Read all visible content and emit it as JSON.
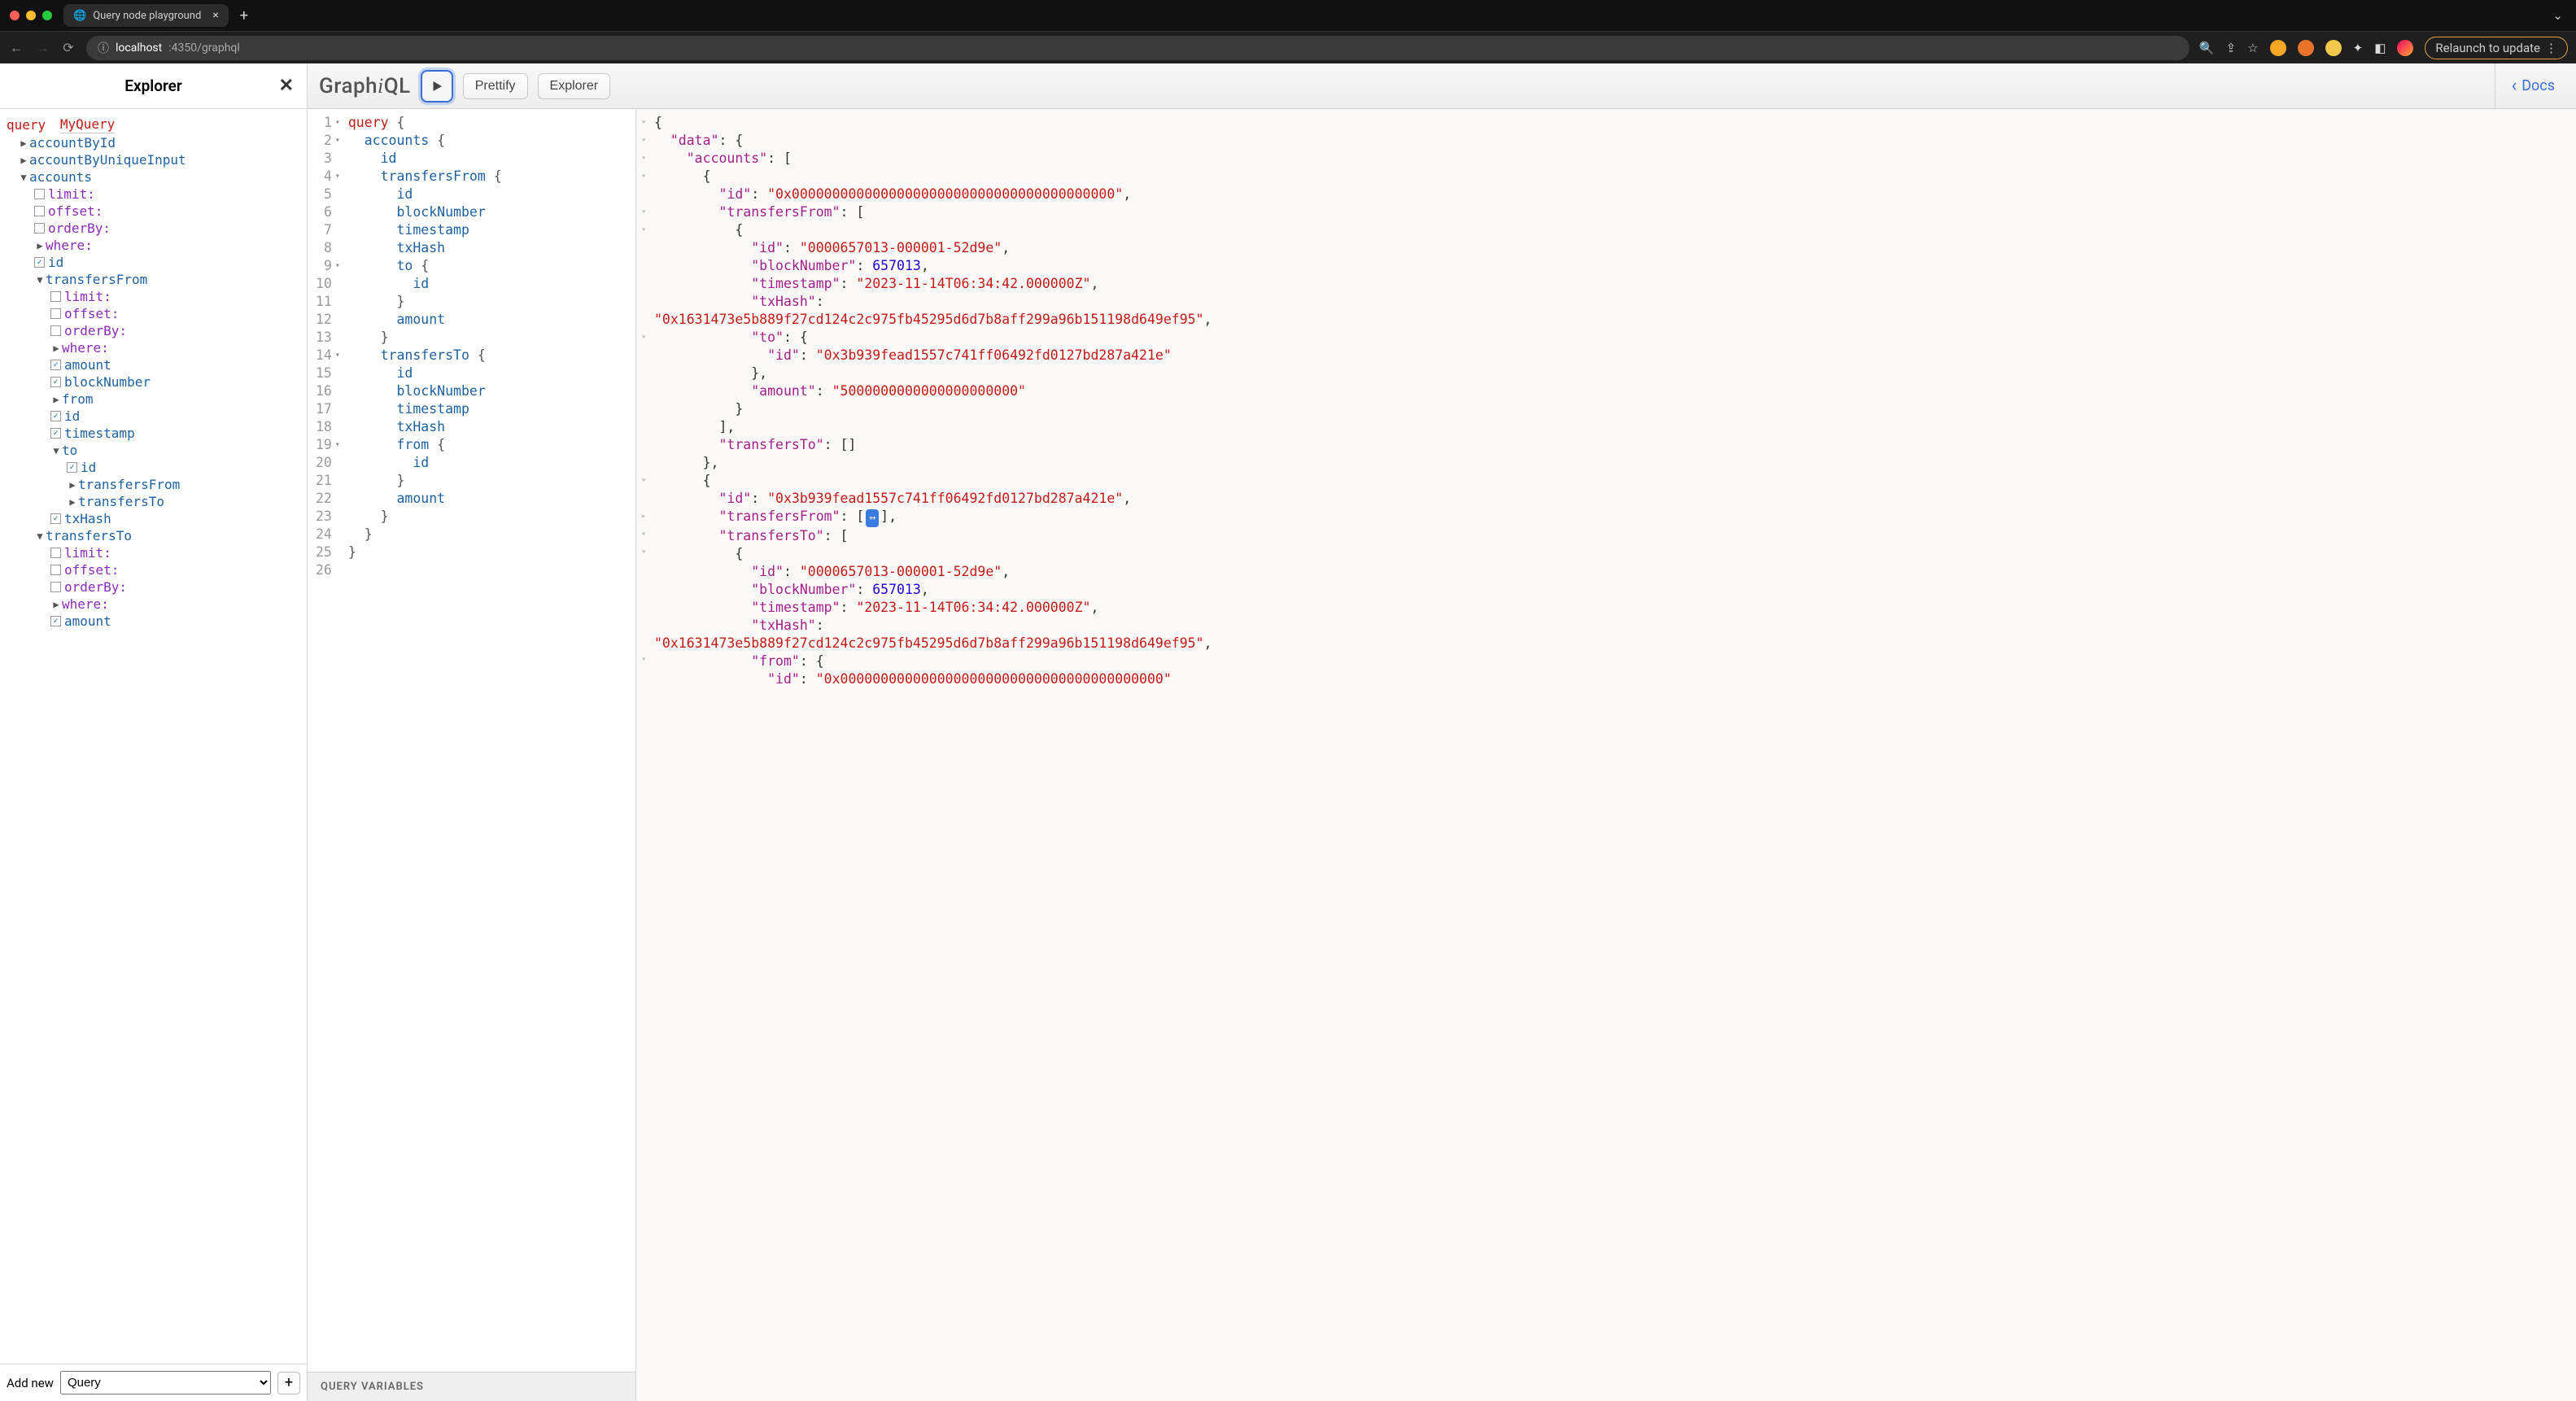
{
  "browser": {
    "tab_title": "Query node playground",
    "url_host": "localhost",
    "url_port_path": ":4350/graphql",
    "relaunch_label": "Relaunch to update"
  },
  "explorer": {
    "title": "Explorer",
    "query_keyword": "query",
    "operation_name": "MyQuery",
    "add_new_label": "Add new",
    "add_new_select": "Query",
    "tree": [
      {
        "indent": 1,
        "caret": "▶",
        "label": "accountById",
        "cls": "field-blue"
      },
      {
        "indent": 1,
        "caret": "▶",
        "label": "accountByUniqueInput",
        "cls": "field-blue"
      },
      {
        "indent": 1,
        "caret": "▼",
        "label": "accounts",
        "cls": "field-blue"
      },
      {
        "indent": 2,
        "checkbox": true,
        "checked": false,
        "label": "limit:",
        "cls": "arg-purple"
      },
      {
        "indent": 2,
        "checkbox": true,
        "checked": false,
        "label": "offset:",
        "cls": "arg-purple"
      },
      {
        "indent": 2,
        "checkbox": true,
        "checked": false,
        "label": "orderBy:",
        "cls": "arg-purple"
      },
      {
        "indent": 2,
        "caret": "▶",
        "label": "where:",
        "cls": "arg-purple"
      },
      {
        "indent": 2,
        "checkbox": true,
        "checked": true,
        "label": "id",
        "cls": "field-blue"
      },
      {
        "indent": 2,
        "caret": "▼",
        "label": "transfersFrom",
        "cls": "field-blue"
      },
      {
        "indent": 3,
        "checkbox": true,
        "checked": false,
        "label": "limit:",
        "cls": "arg-purple"
      },
      {
        "indent": 3,
        "checkbox": true,
        "checked": false,
        "label": "offset:",
        "cls": "arg-purple"
      },
      {
        "indent": 3,
        "checkbox": true,
        "checked": false,
        "label": "orderBy:",
        "cls": "arg-purple"
      },
      {
        "indent": 3,
        "caret": "▶",
        "label": "where:",
        "cls": "arg-purple"
      },
      {
        "indent": 3,
        "checkbox": true,
        "checked": true,
        "label": "amount",
        "cls": "field-blue"
      },
      {
        "indent": 3,
        "checkbox": true,
        "checked": true,
        "label": "blockNumber",
        "cls": "field-blue"
      },
      {
        "indent": 3,
        "caret": "▶",
        "label": "from",
        "cls": "field-blue"
      },
      {
        "indent": 3,
        "checkbox": true,
        "checked": true,
        "label": "id",
        "cls": "field-blue"
      },
      {
        "indent": 3,
        "checkbox": true,
        "checked": true,
        "label": "timestamp",
        "cls": "field-blue"
      },
      {
        "indent": 3,
        "caret": "▼",
        "label": "to",
        "cls": "field-blue"
      },
      {
        "indent": 4,
        "checkbox": true,
        "checked": true,
        "label": "id",
        "cls": "field-blue"
      },
      {
        "indent": 4,
        "caret": "▶",
        "label": "transfersFrom",
        "cls": "field-blue"
      },
      {
        "indent": 4,
        "caret": "▶",
        "label": "transfersTo",
        "cls": "field-blue"
      },
      {
        "indent": 3,
        "checkbox": true,
        "checked": true,
        "label": "txHash",
        "cls": "field-blue"
      },
      {
        "indent": 2,
        "caret": "▼",
        "label": "transfersTo",
        "cls": "field-blue"
      },
      {
        "indent": 3,
        "checkbox": true,
        "checked": false,
        "label": "limit:",
        "cls": "arg-purple"
      },
      {
        "indent": 3,
        "checkbox": true,
        "checked": false,
        "label": "offset:",
        "cls": "arg-purple"
      },
      {
        "indent": 3,
        "checkbox": true,
        "checked": false,
        "label": "orderBy:",
        "cls": "arg-purple"
      },
      {
        "indent": 3,
        "caret": "▶",
        "label": "where:",
        "cls": "arg-purple"
      },
      {
        "indent": 3,
        "checkbox": true,
        "checked": true,
        "label": "amount",
        "cls": "field-blue"
      }
    ]
  },
  "toolbar": {
    "logo_prefix": "Graph",
    "logo_i": "i",
    "logo_suffix": "QL",
    "prettify_label": "Prettify",
    "explorer_label": "Explorer",
    "docs_label": "Docs"
  },
  "editor": {
    "vars_label": "QUERY VARIABLES",
    "lines": [
      {
        "n": 1,
        "fold": "▾",
        "tokens": [
          [
            "kw",
            "query"
          ],
          [
            "sp",
            " "
          ],
          [
            "br",
            "{"
          ]
        ]
      },
      {
        "n": 2,
        "fold": "▾",
        "tokens": [
          [
            "sp",
            "  "
          ],
          [
            "fld",
            "accounts"
          ],
          [
            "sp",
            " "
          ],
          [
            "br",
            "{"
          ]
        ]
      },
      {
        "n": 3,
        "tokens": [
          [
            "sp",
            "    "
          ],
          [
            "fld",
            "id"
          ]
        ]
      },
      {
        "n": 4,
        "fold": "▾",
        "tokens": [
          [
            "sp",
            "    "
          ],
          [
            "fld",
            "transfersFrom"
          ],
          [
            "sp",
            " "
          ],
          [
            "br",
            "{"
          ]
        ]
      },
      {
        "n": 5,
        "tokens": [
          [
            "sp",
            "      "
          ],
          [
            "fld",
            "id"
          ]
        ]
      },
      {
        "n": 6,
        "tokens": [
          [
            "sp",
            "      "
          ],
          [
            "fld",
            "blockNumber"
          ]
        ]
      },
      {
        "n": 7,
        "tokens": [
          [
            "sp",
            "      "
          ],
          [
            "fld",
            "timestamp"
          ]
        ]
      },
      {
        "n": 8,
        "tokens": [
          [
            "sp",
            "      "
          ],
          [
            "fld",
            "txHash"
          ]
        ]
      },
      {
        "n": 9,
        "fold": "▾",
        "tokens": [
          [
            "sp",
            "      "
          ],
          [
            "fld",
            "to"
          ],
          [
            "sp",
            " "
          ],
          [
            "br",
            "{"
          ]
        ]
      },
      {
        "n": 10,
        "tokens": [
          [
            "sp",
            "        "
          ],
          [
            "fld",
            "id"
          ]
        ]
      },
      {
        "n": 11,
        "tokens": [
          [
            "sp",
            "      "
          ],
          [
            "br",
            "}"
          ]
        ]
      },
      {
        "n": 12,
        "tokens": [
          [
            "sp",
            "      "
          ],
          [
            "fld",
            "amount"
          ]
        ]
      },
      {
        "n": 13,
        "tokens": [
          [
            "sp",
            "    "
          ],
          [
            "br",
            "}"
          ]
        ]
      },
      {
        "n": 14,
        "fold": "▾",
        "tokens": [
          [
            "sp",
            "    "
          ],
          [
            "fld",
            "transfersTo"
          ],
          [
            "sp",
            " "
          ],
          [
            "br",
            "{"
          ]
        ]
      },
      {
        "n": 15,
        "tokens": [
          [
            "sp",
            "      "
          ],
          [
            "fld",
            "id"
          ]
        ]
      },
      {
        "n": 16,
        "tokens": [
          [
            "sp",
            "      "
          ],
          [
            "fld",
            "blockNumber"
          ]
        ]
      },
      {
        "n": 17,
        "tokens": [
          [
            "sp",
            "      "
          ],
          [
            "fld",
            "timestamp"
          ]
        ]
      },
      {
        "n": 18,
        "tokens": [
          [
            "sp",
            "      "
          ],
          [
            "fld",
            "txHash"
          ]
        ]
      },
      {
        "n": 19,
        "fold": "▾",
        "tokens": [
          [
            "sp",
            "      "
          ],
          [
            "fld",
            "from"
          ],
          [
            "sp",
            " "
          ],
          [
            "br",
            "{"
          ]
        ]
      },
      {
        "n": 20,
        "tokens": [
          [
            "sp",
            "        "
          ],
          [
            "fld",
            "id"
          ]
        ]
      },
      {
        "n": 21,
        "tokens": [
          [
            "sp",
            "      "
          ],
          [
            "br",
            "}"
          ]
        ]
      },
      {
        "n": 22,
        "tokens": [
          [
            "sp",
            "      "
          ],
          [
            "fld",
            "amount"
          ]
        ]
      },
      {
        "n": 23,
        "tokens": [
          [
            "sp",
            "    "
          ],
          [
            "br",
            "}"
          ]
        ]
      },
      {
        "n": 24,
        "tokens": [
          [
            "sp",
            "  "
          ],
          [
            "br",
            "}"
          ]
        ]
      },
      {
        "n": 25,
        "tokens": [
          [
            "br",
            "}"
          ]
        ]
      },
      {
        "n": 26,
        "tokens": []
      }
    ]
  },
  "result": {
    "lines": [
      {
        "fold": "▾",
        "segs": [
          [
            "p",
            "{"
          ]
        ]
      },
      {
        "fold": "▾",
        "segs": [
          [
            "sp",
            "  "
          ],
          [
            "k",
            "\"data\""
          ],
          [
            "p",
            ": {"
          ]
        ]
      },
      {
        "fold": "▾",
        "segs": [
          [
            "sp",
            "    "
          ],
          [
            "k",
            "\"accounts\""
          ],
          [
            "p",
            ": ["
          ]
        ]
      },
      {
        "fold": "▾",
        "segs": [
          [
            "sp",
            "      "
          ],
          [
            "p",
            "{"
          ]
        ]
      },
      {
        "segs": [
          [
            "sp",
            "        "
          ],
          [
            "k",
            "\"id\""
          ],
          [
            "p",
            ": "
          ],
          [
            "s",
            "\"0x0000000000000000000000000000000000000000\""
          ],
          [
            "p",
            ","
          ]
        ]
      },
      {
        "fold": "▾",
        "segs": [
          [
            "sp",
            "        "
          ],
          [
            "k",
            "\"transfersFrom\""
          ],
          [
            "p",
            ": ["
          ]
        ]
      },
      {
        "fold": "▾",
        "segs": [
          [
            "sp",
            "          "
          ],
          [
            "p",
            "{"
          ]
        ]
      },
      {
        "segs": [
          [
            "sp",
            "            "
          ],
          [
            "k",
            "\"id\""
          ],
          [
            "p",
            ": "
          ],
          [
            "s",
            "\"0000657013-000001-52d9e\""
          ],
          [
            "p",
            ","
          ]
        ]
      },
      {
        "segs": [
          [
            "sp",
            "            "
          ],
          [
            "k",
            "\"blockNumber\""
          ],
          [
            "p",
            ": "
          ],
          [
            "n",
            "657013"
          ],
          [
            "p",
            ","
          ]
        ]
      },
      {
        "segs": [
          [
            "sp",
            "            "
          ],
          [
            "k",
            "\"timestamp\""
          ],
          [
            "p",
            ": "
          ],
          [
            "s",
            "\"2023-11-14T06:34:42.000000Z\""
          ],
          [
            "p",
            ","
          ]
        ]
      },
      {
        "segs": [
          [
            "sp",
            "            "
          ],
          [
            "k",
            "\"txHash\""
          ],
          [
            "p",
            ": "
          ]
        ]
      },
      {
        "segs": [
          [
            "s",
            "\"0x1631473e5b889f27cd124c2c975fb45295d6d7b8aff299a96b151198d649ef95\""
          ],
          [
            "p",
            ","
          ]
        ]
      },
      {
        "fold": "▾",
        "segs": [
          [
            "sp",
            "            "
          ],
          [
            "k",
            "\"to\""
          ],
          [
            "p",
            ": {"
          ]
        ]
      },
      {
        "segs": [
          [
            "sp",
            "              "
          ],
          [
            "k",
            "\"id\""
          ],
          [
            "p",
            ": "
          ],
          [
            "s",
            "\"0x3b939fead1557c741ff06492fd0127bd287a421e\""
          ]
        ]
      },
      {
        "segs": [
          [
            "sp",
            "            "
          ],
          [
            "p",
            "},"
          ]
        ]
      },
      {
        "segs": [
          [
            "sp",
            "            "
          ],
          [
            "k",
            "\"amount\""
          ],
          [
            "p",
            ": "
          ],
          [
            "s",
            "\"5000000000000000000000\""
          ]
        ]
      },
      {
        "segs": [
          [
            "sp",
            "          "
          ],
          [
            "p",
            "}"
          ]
        ]
      },
      {
        "segs": [
          [
            "sp",
            "        "
          ],
          [
            "p",
            "],"
          ]
        ]
      },
      {
        "segs": [
          [
            "sp",
            "        "
          ],
          [
            "k",
            "\"transfersTo\""
          ],
          [
            "p",
            ": []"
          ]
        ]
      },
      {
        "segs": [
          [
            "sp",
            "      "
          ],
          [
            "p",
            "},"
          ]
        ]
      },
      {
        "fold": "▾",
        "segs": [
          [
            "sp",
            "      "
          ],
          [
            "p",
            "{"
          ]
        ]
      },
      {
        "segs": [
          [
            "sp",
            "        "
          ],
          [
            "k",
            "\"id\""
          ],
          [
            "p",
            ": "
          ],
          [
            "s",
            "\"0x3b939fead1557c741ff06492fd0127bd287a421e\""
          ],
          [
            "p",
            ","
          ]
        ]
      },
      {
        "fold": "▸",
        "segs": [
          [
            "sp",
            "        "
          ],
          [
            "k",
            "\"transfersFrom\""
          ],
          [
            "p",
            ": ["
          ],
          [
            "pill",
            "↔"
          ],
          [
            "p",
            "],"
          ]
        ]
      },
      {
        "fold": "▾",
        "segs": [
          [
            "sp",
            "        "
          ],
          [
            "k",
            "\"transfersTo\""
          ],
          [
            "p",
            ": ["
          ]
        ]
      },
      {
        "fold": "▾",
        "segs": [
          [
            "sp",
            "          "
          ],
          [
            "p",
            "{"
          ]
        ]
      },
      {
        "segs": [
          [
            "sp",
            "            "
          ],
          [
            "k",
            "\"id\""
          ],
          [
            "p",
            ": "
          ],
          [
            "s",
            "\"0000657013-000001-52d9e\""
          ],
          [
            "p",
            ","
          ]
        ]
      },
      {
        "segs": [
          [
            "sp",
            "            "
          ],
          [
            "k",
            "\"blockNumber\""
          ],
          [
            "p",
            ": "
          ],
          [
            "n",
            "657013"
          ],
          [
            "p",
            ","
          ]
        ]
      },
      {
        "segs": [
          [
            "sp",
            "            "
          ],
          [
            "k",
            "\"timestamp\""
          ],
          [
            "p",
            ": "
          ],
          [
            "s",
            "\"2023-11-14T06:34:42.000000Z\""
          ],
          [
            "p",
            ","
          ]
        ]
      },
      {
        "segs": [
          [
            "sp",
            "            "
          ],
          [
            "k",
            "\"txHash\""
          ],
          [
            "p",
            ": "
          ]
        ]
      },
      {
        "segs": [
          [
            "s",
            "\"0x1631473e5b889f27cd124c2c975fb45295d6d7b8aff299a96b151198d649ef95\""
          ],
          [
            "p",
            ","
          ]
        ]
      },
      {
        "fold": "▾",
        "segs": [
          [
            "sp",
            "            "
          ],
          [
            "k",
            "\"from\""
          ],
          [
            "p",
            ": {"
          ]
        ]
      },
      {
        "segs": [
          [
            "sp",
            "              "
          ],
          [
            "k",
            "\"id\""
          ],
          [
            "p",
            ": "
          ],
          [
            "s",
            "\"0x0000000000000000000000000000000000000000\""
          ]
        ]
      }
    ]
  }
}
